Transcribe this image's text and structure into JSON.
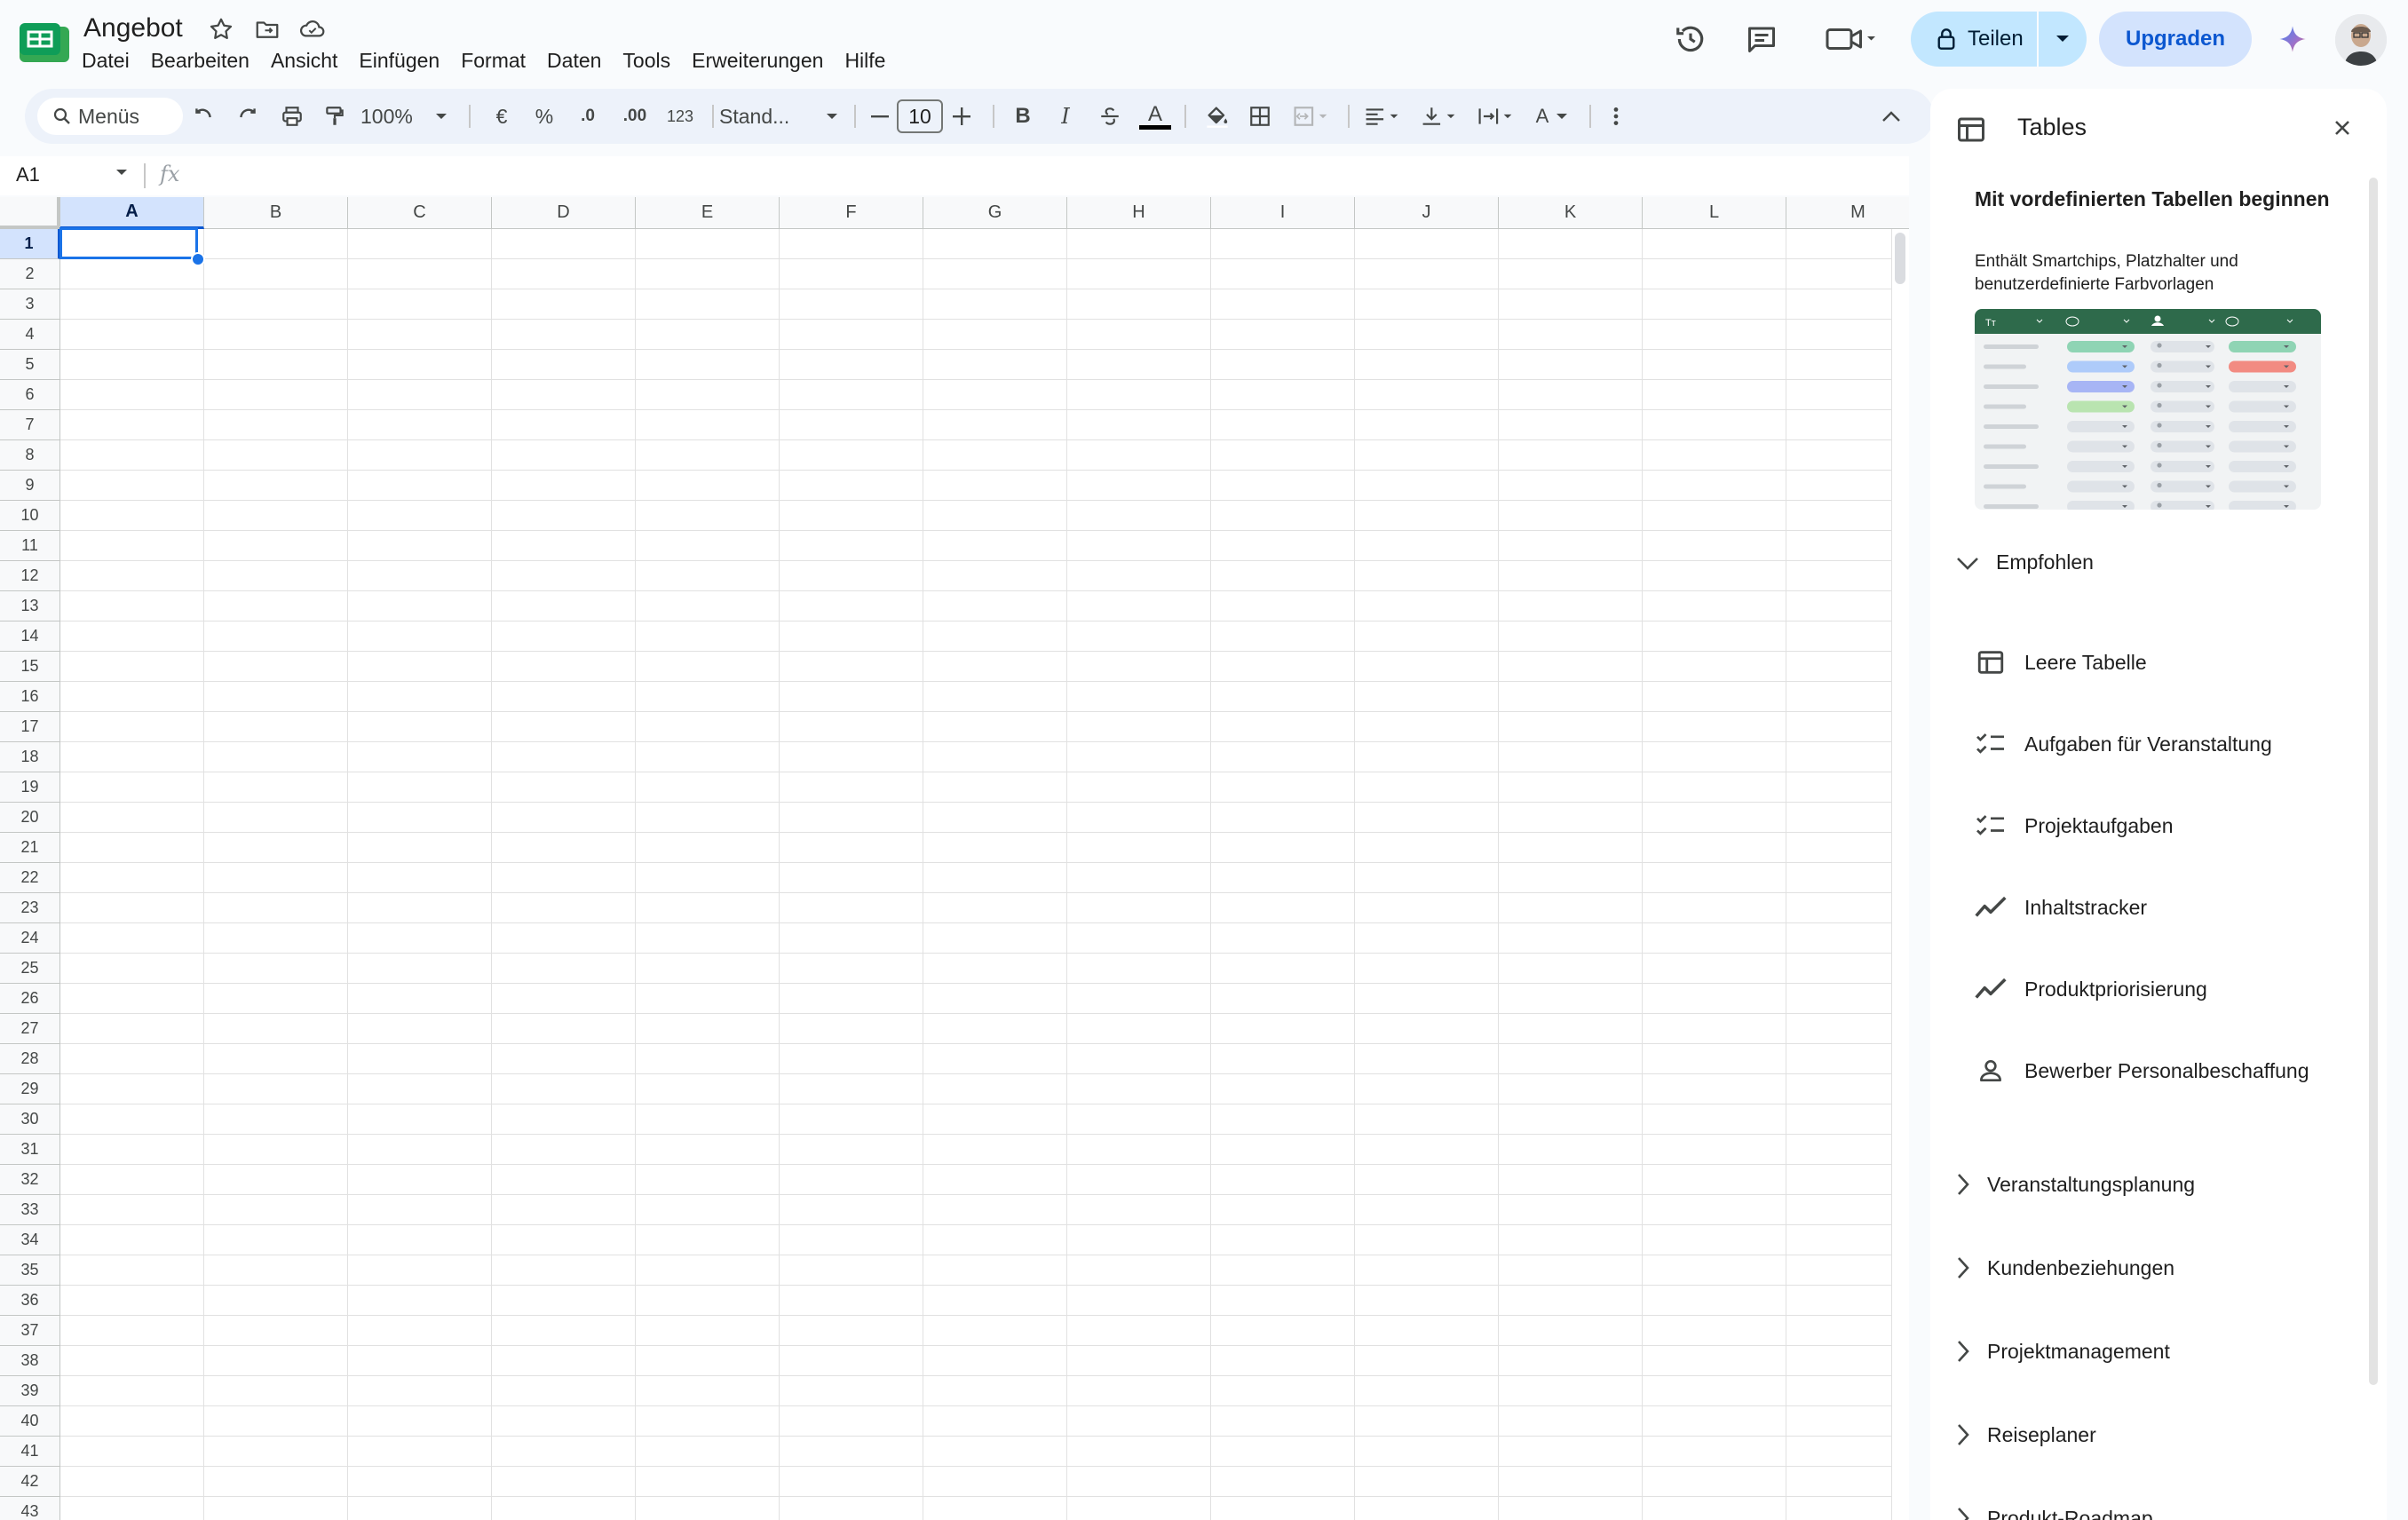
{
  "doc": {
    "title": "Angebot"
  },
  "menu": [
    "Datei",
    "Bearbeiten",
    "Ansicht",
    "Einfügen",
    "Format",
    "Daten",
    "Tools",
    "Erweiterungen",
    "Hilfe"
  ],
  "header": {
    "share_label": "Teilen",
    "upgrade_label": "Upgraden"
  },
  "toolbar": {
    "search_label": "Menüs",
    "zoom": "100%",
    "currency": "€",
    "percent": "%",
    "decimal_decrease": ".0",
    "decimal_increase": ".00",
    "number_format": "123",
    "font_name": "Stand...",
    "font_size": "10",
    "bold": "B",
    "italic": "I",
    "text_color_glyph": "A",
    "text_rotation_glyph": "A"
  },
  "formula_bar": {
    "cell_ref": "A1",
    "fx": "fx"
  },
  "grid": {
    "columns": [
      "A",
      "B",
      "C",
      "D",
      "E",
      "F",
      "G",
      "H",
      "I",
      "J",
      "K",
      "L",
      "M"
    ],
    "rows": [
      "1",
      "2",
      "3",
      "4",
      "5",
      "6",
      "7",
      "8",
      "9",
      "10",
      "11",
      "12",
      "13",
      "14",
      "15",
      "16",
      "17",
      "18",
      "19",
      "20",
      "21",
      "22",
      "23",
      "24",
      "25",
      "26",
      "27",
      "28",
      "29",
      "30",
      "31",
      "32",
      "33",
      "34",
      "35",
      "36",
      "37",
      "38",
      "39",
      "40",
      "41",
      "42",
      "43"
    ],
    "selected_column": "A",
    "selected_row": "1"
  },
  "panel": {
    "title": "Tables",
    "intro_title": "Mit vordefinierten Tabellen beginnen",
    "intro_desc": "Enthält Smartchips, Platzhalter und benutzerdefinierte Farbvorlagen",
    "recommended_label": "Empfohlen",
    "recommended": [
      {
        "label": "Leere Tabelle",
        "icon": "table-icon"
      },
      {
        "label": "Aufgaben für Veranstaltung",
        "icon": "checklist-icon"
      },
      {
        "label": "Projektaufgaben",
        "icon": "checklist-icon"
      },
      {
        "label": "Inhaltstracker",
        "icon": "trend-icon"
      },
      {
        "label": "Produktpriorisierung",
        "icon": "trend-icon"
      },
      {
        "label": "Bewerber Personalbeschaffung",
        "icon": "person-icon"
      }
    ],
    "categories": [
      "Veranstaltungsplanung",
      "Kundenbeziehungen",
      "Projektmanagement",
      "Reiseplaner",
      "Produkt-Roadmap"
    ]
  },
  "colors": {
    "accent": "#0b57d0",
    "share_bg": "#c2e7ff",
    "sheets_green": "#0f9d58",
    "preview_header": "#2e6a4b"
  }
}
